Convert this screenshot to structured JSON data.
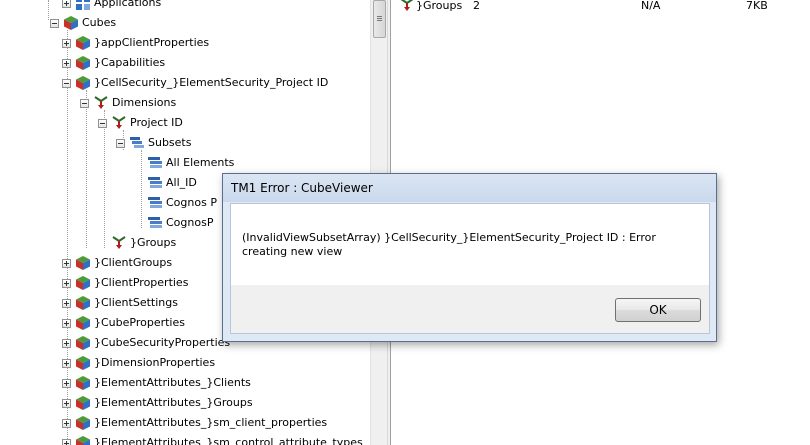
{
  "tree": {
    "items": [
      {
        "label": "Applications",
        "level": 2,
        "expander": "plus",
        "icon": "applications-icon"
      },
      {
        "label": "Cubes",
        "level": 1,
        "expander": "minus",
        "icon": "cubes-folder-icon"
      },
      {
        "label": "}appClientProperties",
        "level": 2,
        "expander": "plus",
        "icon": "cube-icon"
      },
      {
        "label": "}Capabilities",
        "level": 2,
        "expander": "plus",
        "icon": "cube-icon"
      },
      {
        "label": "}CellSecurity_}ElementSecurity_Project ID",
        "level": 2,
        "expander": "minus",
        "icon": "cube-icon"
      },
      {
        "label": "Dimensions",
        "level": 3,
        "expander": "minus",
        "icon": "dimensions-icon"
      },
      {
        "label": "Project ID",
        "level": 4,
        "expander": "minus",
        "icon": "dimension-icon"
      },
      {
        "label": "Subsets",
        "level": 5,
        "expander": "minus",
        "icon": "subsets-icon"
      },
      {
        "label": "All Elements",
        "level": 6,
        "expander": "none",
        "icon": "subset-icon"
      },
      {
        "label": "All_ID",
        "level": 6,
        "expander": "none",
        "icon": "subset-icon"
      },
      {
        "label": "Cognos P",
        "level": 6,
        "expander": "none",
        "icon": "subset-icon"
      },
      {
        "label": "CognosP",
        "level": 6,
        "expander": "none",
        "icon": "subset-icon"
      },
      {
        "label": "}Groups",
        "level": 4,
        "expander": "none",
        "icon": "dimension-icon"
      },
      {
        "label": "}ClientGroups",
        "level": 2,
        "expander": "plus",
        "icon": "cube-icon"
      },
      {
        "label": "}ClientProperties",
        "level": 2,
        "expander": "plus",
        "icon": "cube-icon"
      },
      {
        "label": "}ClientSettings",
        "level": 2,
        "expander": "plus",
        "icon": "cube-icon"
      },
      {
        "label": "}CubeProperties",
        "level": 2,
        "expander": "plus",
        "icon": "cube-icon"
      },
      {
        "label": "}CubeSecurityProperties",
        "level": 2,
        "expander": "plus",
        "icon": "cube-icon"
      },
      {
        "label": "}DimensionProperties",
        "level": 2,
        "expander": "plus",
        "icon": "cube-icon"
      },
      {
        "label": "}ElementAttributes_}Clients",
        "level": 2,
        "expander": "plus",
        "icon": "cube-icon"
      },
      {
        "label": "}ElementAttributes_}Groups",
        "level": 2,
        "expander": "plus",
        "icon": "cube-icon"
      },
      {
        "label": "}ElementAttributes_}sm_client_properties",
        "level": 2,
        "expander": "plus",
        "icon": "cube-icon"
      },
      {
        "label": "}ElementAttributes_}sm_control_attribute_types",
        "level": 2,
        "expander": "plus",
        "icon": "cube-icon"
      }
    ]
  },
  "list": {
    "row": {
      "name": "}Groups",
      "count": "2",
      "status": "N/A",
      "size": "7KB",
      "icon": "dimension-icon"
    }
  },
  "dialog": {
    "title": "TM1 Error : CubeViewer",
    "message": "(InvalidViewSubsetArray) }CellSecurity_}ElementSecurity_Project ID : Error creating new view",
    "ok_label": "OK"
  }
}
